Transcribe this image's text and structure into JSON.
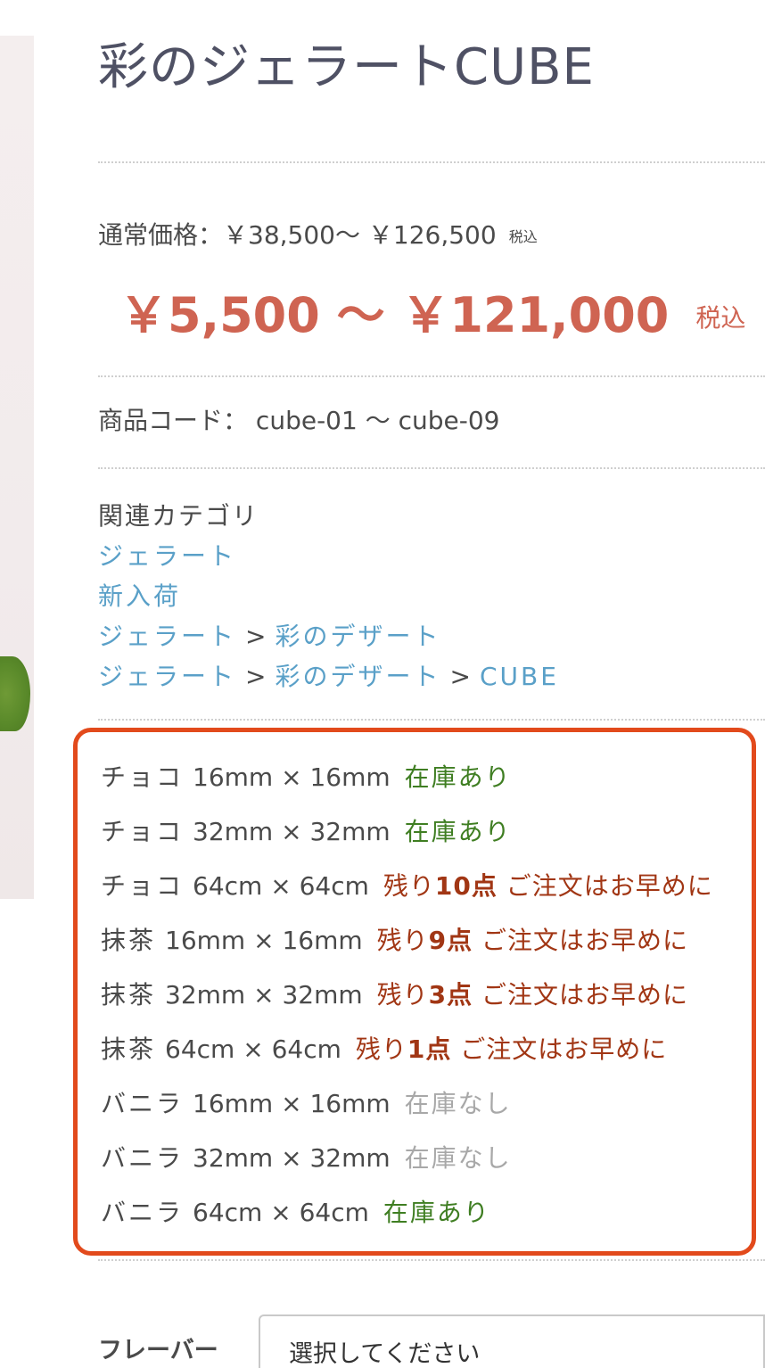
{
  "product": {
    "title": "彩のジェラートCUBE",
    "regular_price_label": "通常価格：",
    "regular_price_range": "￥38,500～ ￥126,500",
    "regular_price_tax": "税込",
    "sale_price_range": "￥5,500 ～ ￥121,000",
    "sale_price_tax": "税込",
    "code_label": "商品コード：",
    "code_range": "cube-01 ～ cube-09"
  },
  "categories": {
    "label": "関連カテゴリ",
    "separator": ">",
    "gelato": "ジェラート",
    "new_arrival": "新入荷",
    "aya_dessert": "彩のデザート",
    "cube": "CUBE"
  },
  "stock": {
    "rows": [
      {
        "flavor": "チョコ",
        "size": "16mm × 16mm",
        "status": "在庫あり"
      },
      {
        "flavor": "チョコ",
        "size": "32mm × 32mm",
        "status": "在庫あり"
      },
      {
        "flavor": "チョコ",
        "size": "64cm × 64cm",
        "status_prefix": "残り",
        "status_count": "10点",
        "status_suffix": " ご注文はお早めに"
      },
      {
        "flavor": "抹茶",
        "size": "16mm × 16mm",
        "status_prefix": "残り",
        "status_count": "9点",
        "status_suffix": " ご注文はお早めに"
      },
      {
        "flavor": "抹茶",
        "size": "32mm × 32mm",
        "status_prefix": "残り",
        "status_count": "3点",
        "status_suffix": " ご注文はお早めに"
      },
      {
        "flavor": "抹茶",
        "size": "64cm × 64cm",
        "status_prefix": "残り",
        "status_count": "1点",
        "status_suffix": " ご注文はお早めに"
      },
      {
        "flavor": "バニラ",
        "size": "16mm × 16mm",
        "status": "在庫なし"
      },
      {
        "flavor": "バニラ",
        "size": "32mm × 32mm",
        "status": "在庫なし"
      },
      {
        "flavor": "バニラ",
        "size": "64cm × 64cm",
        "status": "在庫あり"
      }
    ]
  },
  "options": {
    "flavor_label": "フレーバー",
    "flavor_select_value": "選択してください"
  },
  "colors": {
    "title": "#4f5164",
    "sale_price": "#cf6452",
    "link": "#5aa0c8",
    "in_stock": "#3f7e22",
    "out_of_stock": "#a8a8a8",
    "low_stock": "#a13614",
    "highlight_border": "#e24a1c"
  }
}
